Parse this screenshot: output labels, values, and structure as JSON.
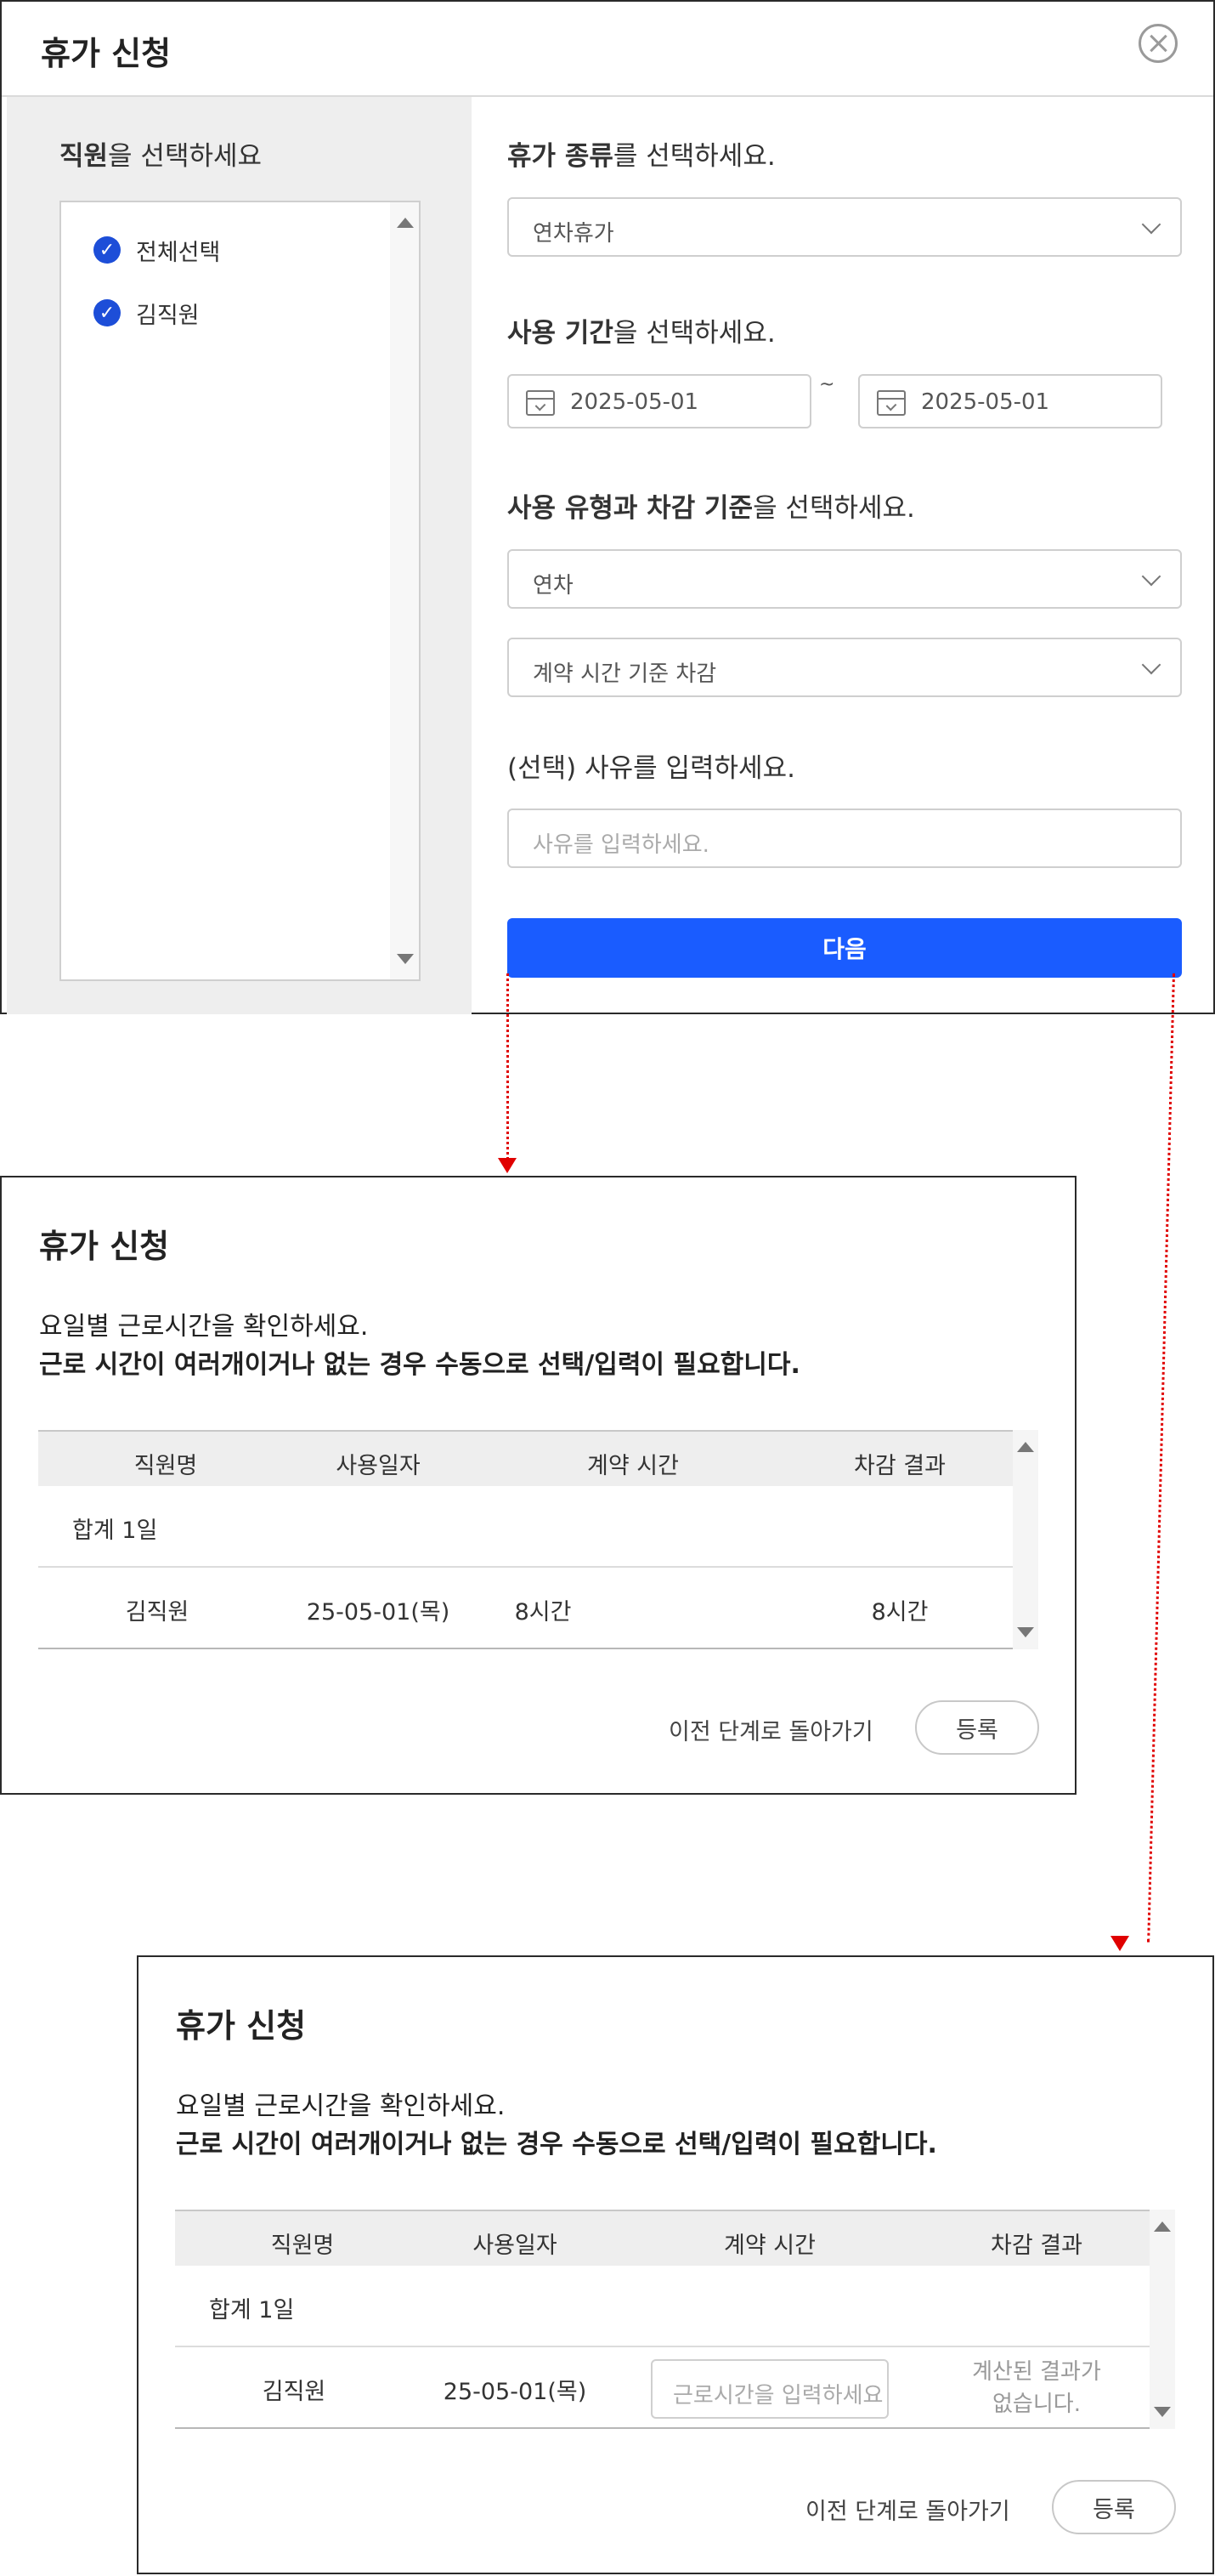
{
  "modal": {
    "title": "휴가 신청",
    "employee_section": {
      "title_bold": "직원",
      "title_rest": "을 선택하세요",
      "items": [
        {
          "label": "전체선택",
          "checked": true
        },
        {
          "label": "김직원",
          "checked": true
        }
      ]
    },
    "leave_type": {
      "title_bold": "휴가 종류",
      "title_rest": "를 선택하세요.",
      "value": "연차휴가"
    },
    "period": {
      "title_bold": "사용 기간",
      "title_rest": "을 선택하세요.",
      "start": "2025-05-01",
      "separator": "~",
      "end": "2025-05-01"
    },
    "usage": {
      "title_bold": "사용 유형과 차감 기준",
      "title_rest": "을 선택하세요.",
      "type_value": "연차",
      "deduction_value": "계약 시간 기준 차감"
    },
    "reason": {
      "title": "(선택) 사유를 입력하세요.",
      "placeholder": "사유를 입력하세요."
    },
    "next_label": "다음"
  },
  "confirm_a": {
    "title": "휴가 신청",
    "instruction1": "요일별 근로시간을 확인하세요.",
    "instruction2": "근로 시간이 여러개이거나 없는 경우 수동으로 선택/입력이 필요합니다.",
    "headers": [
      "직원명",
      "사용일자",
      "계약 시간",
      "차감 결과"
    ],
    "summary": "합계 1일",
    "row": {
      "name": "김직원",
      "date": "25-05-01(목)",
      "contract": "8시간",
      "result": "8시간"
    },
    "back_label": "이전 단계로 돌아가기",
    "register_label": "등록"
  },
  "confirm_b": {
    "title": "휴가 신청",
    "instruction1": "요일별 근로시간을 확인하세요.",
    "instruction2": "근로 시간이 여러개이거나 없는 경우 수동으로 선택/입력이 필요합니다.",
    "headers": [
      "직원명",
      "사용일자",
      "계약 시간",
      "차감 결과"
    ],
    "summary": "합계 1일",
    "row": {
      "name": "김직원",
      "date": "25-05-01(목)",
      "contract_placeholder": "근로시간을 입력하세요",
      "result_line1": "계산된 결과가",
      "result_line2": "없습니다."
    },
    "back_label": "이전 단계로 돌아가기",
    "register_label": "등록"
  },
  "colors": {
    "primary": "#1a5cff",
    "check": "#1d4ed8",
    "arrow": "#e00000"
  }
}
